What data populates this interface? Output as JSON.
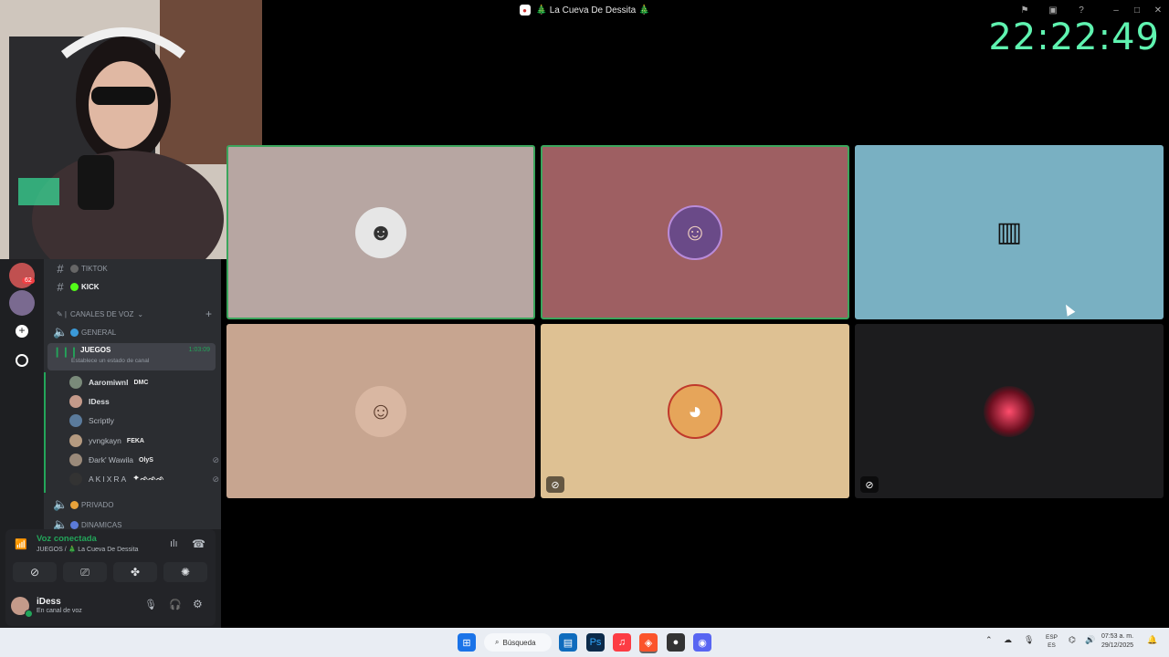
{
  "window": {
    "title": "🎄 La Cueva De Dessita 🎄",
    "buttons": [
      "minimize",
      "maximize",
      "close"
    ]
  },
  "overlay_clock": "22:22:49",
  "guilds": [
    {
      "icon": "server-avatar-1",
      "badge": "62"
    },
    {
      "icon": "server-avatar-2"
    },
    {
      "icon": "add-server-icon"
    },
    {
      "icon": "discover-icon"
    }
  ],
  "channels": {
    "text": [
      {
        "name": "TIKTOK",
        "emoji_color": "#8a8a8a"
      },
      {
        "name": "KICK",
        "emoji_color": "#53fc18"
      }
    ],
    "voice_category": "CANALES DE VOZ",
    "voice": [
      {
        "name": "GENERAL"
      },
      {
        "name": "JUEGOS",
        "timer": "1:03:09",
        "status": "Establece un estado de canal"
      },
      {
        "name": "PRIVADO"
      },
      {
        "name": "DINAMICAS"
      }
    ],
    "members": [
      {
        "name": "Aaromiwnl",
        "tag": "DMC",
        "color": "#7a8a7a"
      },
      {
        "name": "IDess",
        "tag": "",
        "color": "#c49a8a"
      },
      {
        "name": "Scriptly",
        "tag": "",
        "color": "#5b7b9c"
      },
      {
        "name": "yvngkayn",
        "tag": "FEKA",
        "color": "#b59a80"
      },
      {
        "name": "Ðark' Wawila",
        "tag": "OlyS",
        "color": "#9a8a7a"
      },
      {
        "name": "AKIXRA",
        "tag": "✦ ᨒᨒᨒ",
        "color": "#333"
      }
    ]
  },
  "voice_panel": {
    "status": "Voz conectada",
    "location": "JUEGOS / 🎄 La Cueva De Dessita",
    "buttons": [
      "video-off-icon",
      "screenshare-icon",
      "activities-icon",
      "soundboard-icon"
    ]
  },
  "user": {
    "name": "iDess",
    "status": "En canal de voz"
  },
  "tiles": [
    {
      "color": "#b7a6a2",
      "speaking": true,
      "avatar": "hockey-mask-avatar",
      "avatar_bg": "#e0e0e0",
      "muted": false
    },
    {
      "color": "#9e5f62",
      "speaking": true,
      "avatar": "sunglasses-girl-avatar",
      "avatar_bg": "#6a4a88",
      "muted": false
    },
    {
      "color": "#79b0c2",
      "speaking": false,
      "avatar": "audio-bot-avatar",
      "avatar_bg": "#79b0c2",
      "muted": false
    },
    {
      "color": "#c7a590",
      "speaking": false,
      "avatar": "girl-face-avatar",
      "avatar_bg": "#d9b7a2",
      "muted": false
    },
    {
      "color": "#dec193",
      "speaking": false,
      "avatar": "dog-avatar",
      "avatar_bg": "#e6a55a",
      "muted": true
    },
    {
      "color": "#1c1c1e",
      "speaking": false,
      "avatar": "red-orb-avatar",
      "avatar_bg": "#2a0d14",
      "muted": true
    }
  ],
  "taskbar": {
    "search_label": "Búsqueda",
    "lang": "ESP",
    "region": "ES",
    "time": "07:53 a. m.",
    "date": "29/12/2025"
  }
}
